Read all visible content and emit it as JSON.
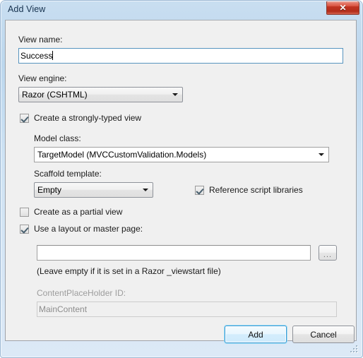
{
  "window": {
    "title": "Add View",
    "close_label": "✕",
    "close_icon": "close-icon",
    "accent_blue": "#3c9bd4",
    "close_red": "#c03522",
    "client_bg": "#f0f0f0",
    "frame_bg": "#cfe3f4"
  },
  "form": {
    "view_name_label": "View name:",
    "view_name_value": "Success",
    "view_engine_label": "View engine:",
    "view_engine_value": "Razor (CSHTML)",
    "strongly_typed_label": "Create a strongly-typed view",
    "strongly_typed_checked": true,
    "model_class_label": "Model class:",
    "model_class_value": "TargetModel (MVCCustomValidation.Models)",
    "scaffold_label": "Scaffold template:",
    "scaffold_value": "Empty",
    "reference_scripts_label": "Reference script libraries",
    "reference_scripts_checked": true,
    "partial_view_label": "Create as a partial view",
    "partial_view_checked": false,
    "layout_label": "Use a layout or master page:",
    "layout_checked": true,
    "layout_path_value": "",
    "browse_label": "...",
    "layout_hint": "(Leave empty if it is set in a Razor _viewstart file)",
    "placeholder_label": "ContentPlaceHolder ID:",
    "placeholder_value": "MainContent"
  },
  "footer": {
    "add_label": "Add",
    "cancel_label": "Cancel"
  }
}
